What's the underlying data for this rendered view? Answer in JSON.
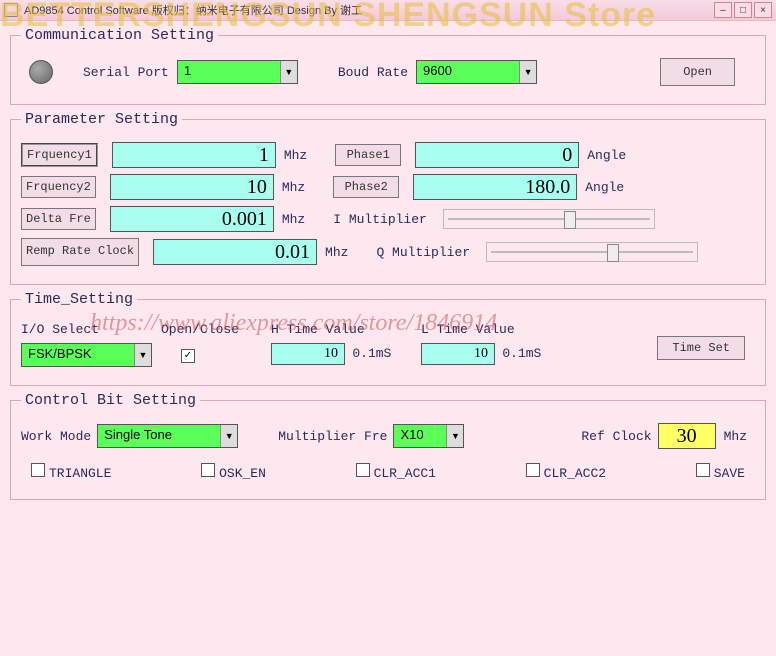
{
  "title": "AD9854 Control Software   版权归：纳米电子有限公司   Design By 谢工",
  "watermark_store": "BETTERSHENGSUN SHENGSUN Store",
  "watermark_url": "https://www.aliexpress.com/store/1846914",
  "comm": {
    "legend": "Communication Setting",
    "serial_label": "Serial Port",
    "serial_value": "1",
    "baud_label": "Boud Rate",
    "baud_value": "9600",
    "open_btn": "Open"
  },
  "param": {
    "legend": "Parameter Setting",
    "freq1_btn": "Frquency1",
    "freq1_val": "1",
    "freq1_unit": "Mhz",
    "freq2_btn": "Frquency2",
    "freq2_val": "10",
    "freq2_unit": "Mhz",
    "delta_btn": "Delta Fre",
    "delta_val": "0.001",
    "delta_unit": "Mhz",
    "ramp_btn": "Remp Rate Clock",
    "ramp_val": "0.01",
    "ramp_unit": "Mhz",
    "phase1_btn": "Phase1",
    "phase1_val": "0",
    "phase1_unit": "Angle",
    "phase2_btn": "Phase2",
    "phase2_val": "180.0",
    "phase2_unit": "Angle",
    "imult": "I Multiplier",
    "qmult": "Q Multiplier"
  },
  "time": {
    "legend": "Time_Setting",
    "io_label": "I/O Select",
    "io_value": "FSK/BPSK",
    "oc_label": "Open/Close",
    "oc_checked": true,
    "h_label": "H Time Value",
    "h_val": "10",
    "h_unit": "0.1mS",
    "l_label": "L Time Value",
    "l_val": "10",
    "l_unit": "0.1mS",
    "set_btn": "Time Set"
  },
  "ctrl": {
    "legend": "Control Bit Setting",
    "mode_label": "Work Mode",
    "mode_value": "Single Tone",
    "mult_label": "Multiplier Fre",
    "mult_value": "X10",
    "ref_label": "Ref Clock",
    "ref_val": "30",
    "ref_unit": "Mhz",
    "cb": [
      "TRIANGLE",
      "OSK_EN",
      "CLR_ACC1",
      "CLR_ACC2",
      "SAVE"
    ]
  }
}
